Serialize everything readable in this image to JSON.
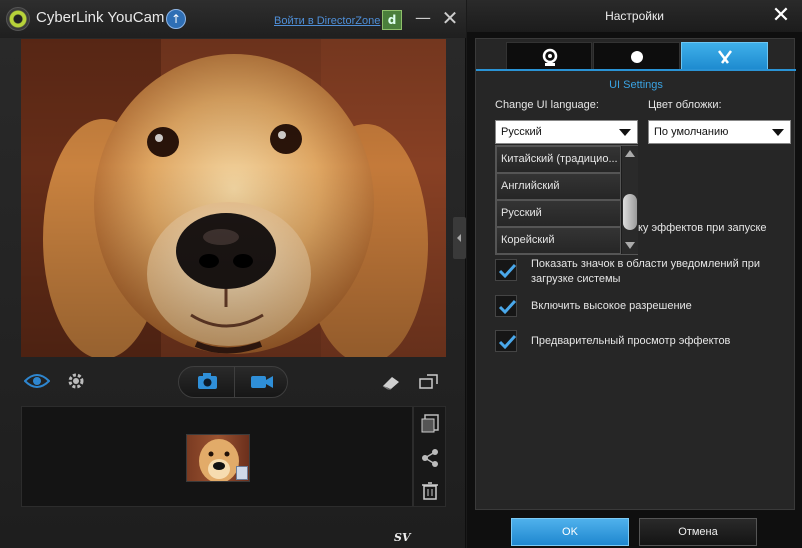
{
  "app": {
    "title": "CyberLink YouCam",
    "director_zone_link": "Войти в DirectorZone",
    "watermark": "SV"
  },
  "preview": {
    "subject": "golden retriever face (live camera preview)"
  },
  "capture": {
    "photo_icon": "camera-icon",
    "video_icon": "video-camera-icon"
  },
  "settings": {
    "title": "Настройки",
    "tabs": [
      {
        "icon": "webcam-icon",
        "active": false
      },
      {
        "icon": "record-dot-icon",
        "active": false
      },
      {
        "icon": "tools-icon",
        "active": true
      }
    ],
    "section_title": "UI Settings",
    "language_label": "Change UI language:",
    "language_value": "Русский",
    "skin_label": "Цвет обложки:",
    "skin_value": "По умолчанию",
    "language_options": [
      "Китайский (традицио...",
      "Английский",
      "Русский",
      "Корейский"
    ],
    "hidden_checkbox_text": "ку эффектов при запуске",
    "checkboxes": [
      {
        "label": "Показать значок в области уведомлений при загрузке системы",
        "checked": true
      },
      {
        "label": "Включить высокое разрешение",
        "checked": true
      },
      {
        "label": "Предварительный просмотр эффектов",
        "checked": true
      }
    ],
    "ok_label": "OK",
    "cancel_label": "Отмена"
  },
  "colors": {
    "accent": "#2a93d5",
    "section_title": "#3aa3e3",
    "checkmark": "#4aa8ea"
  }
}
